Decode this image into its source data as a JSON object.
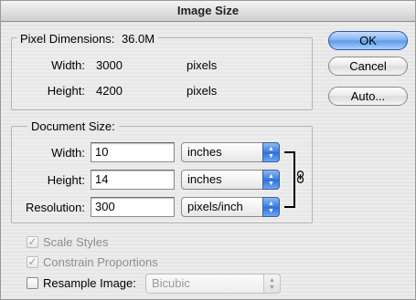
{
  "window": {
    "title": "Image Size"
  },
  "pixel_dimensions": {
    "label": "Pixel Dimensions:",
    "value": "36.0M",
    "width_label": "Width:",
    "width_value": "3000",
    "width_unit": "pixels",
    "height_label": "Height:",
    "height_value": "4200",
    "height_unit": "pixels"
  },
  "document_size": {
    "label": "Document Size:",
    "width_label": "Width:",
    "width_value": "10",
    "width_unit": "inches",
    "height_label": "Height:",
    "height_value": "14",
    "height_unit": "inches",
    "resolution_label": "Resolution:",
    "resolution_value": "300",
    "resolution_unit": "pixels/inch",
    "link_icon": "chain-link-icon"
  },
  "buttons": {
    "ok": "OK",
    "cancel": "Cancel",
    "auto": "Auto..."
  },
  "options": {
    "scale_styles": "Scale Styles",
    "scale_styles_checked": "✓",
    "constrain_proportions": "Constrain Proportions",
    "constrain_proportions_checked": "✓",
    "resample_image": "Resample Image:",
    "resample_method": "Bicubic"
  }
}
